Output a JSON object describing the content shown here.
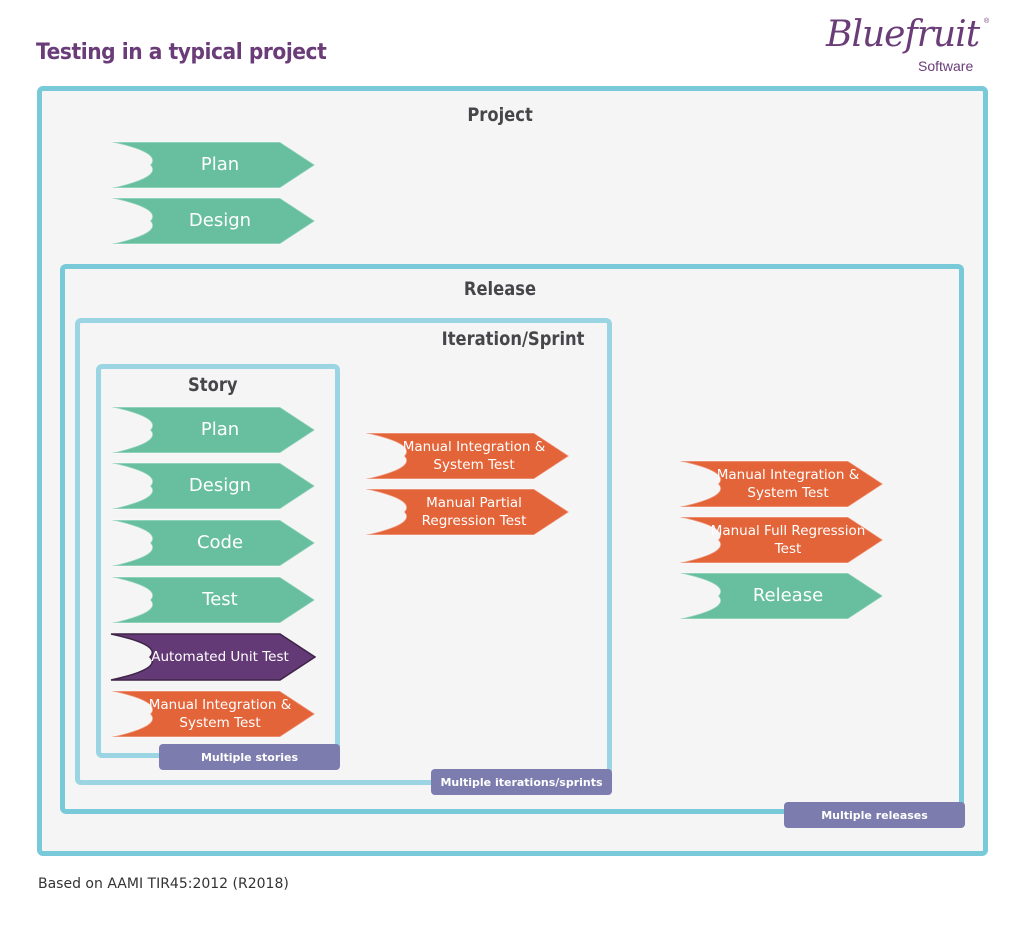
{
  "title": "Testing in a typical project",
  "logo": {
    "name": "Bluefruit",
    "sub": "Software",
    "reg": "®"
  },
  "colors": {
    "green": "#67bf9f",
    "orange": "#e4643a",
    "purple": "#643a76",
    "tag": "#7c7cae",
    "border": "#78cad9",
    "title": "#6a3c78"
  },
  "project": {
    "label": "Project",
    "steps": [
      {
        "label": "Plan",
        "type": "green"
      },
      {
        "label": "Design",
        "type": "green"
      }
    ]
  },
  "release": {
    "label": "Release",
    "tag": "Multiple releases",
    "steps": [
      {
        "label": "Manual Integration & System Test",
        "type": "orange"
      },
      {
        "label": "Manual Full Regression Test",
        "type": "orange"
      },
      {
        "label": "Release",
        "type": "green"
      }
    ]
  },
  "iteration": {
    "label": "Iteration/Sprint",
    "tag": "Multiple iterations/sprints",
    "steps": [
      {
        "label": "Manual Integration & System Test",
        "type": "orange"
      },
      {
        "label": "Manual Partial Regression Test",
        "type": "orange"
      }
    ]
  },
  "story": {
    "label": "Story",
    "tag": "Multiple stories",
    "steps": [
      {
        "label": "Plan",
        "type": "green"
      },
      {
        "label": "Design",
        "type": "green"
      },
      {
        "label": "Code",
        "type": "green"
      },
      {
        "label": "Test",
        "type": "green"
      },
      {
        "label": "Automated Unit Test",
        "type": "purple"
      },
      {
        "label": "Manual Integration & System Test",
        "type": "orange"
      }
    ]
  },
  "footnote": "Based on AAMI TIR45:2012 (R2018)"
}
